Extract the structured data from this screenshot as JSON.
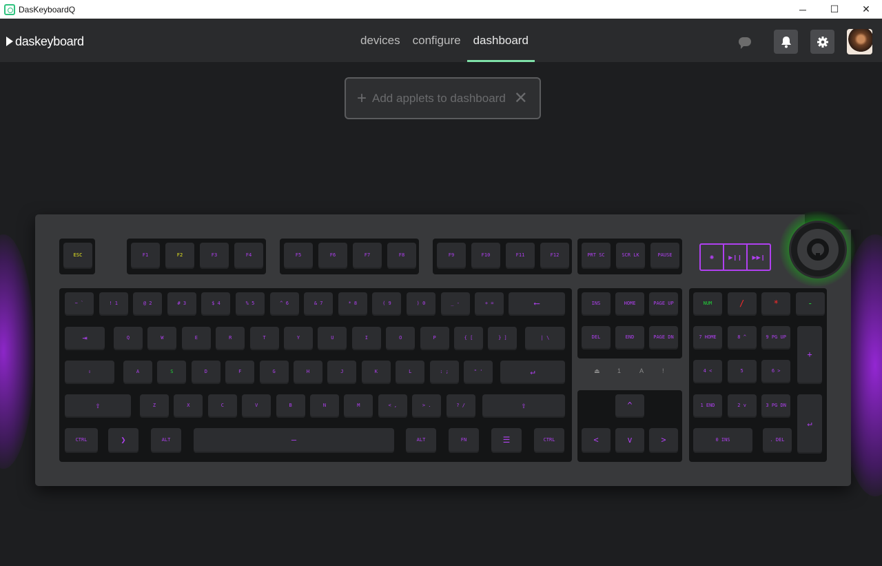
{
  "window": {
    "title": "DasKeyboardQ"
  },
  "header": {
    "logo_text": "daskeyboard",
    "tabs": [
      "devices",
      "configure",
      "dashboard"
    ],
    "active_tab": "dashboard"
  },
  "applet_bar": {
    "label": "Add applets to dashboard"
  },
  "keyboard": {
    "lighting": {
      "base": "#b040f0",
      "yellow": "#e8e820",
      "green": "#22d43a",
      "red": "#ff2a2a",
      "dial": "#28e628"
    },
    "indicators": [
      "⏏",
      "1",
      "A",
      "!"
    ],
    "keys": [
      {
        "id": "esc",
        "label": "ESC",
        "sub": "",
        "c": "ylw"
      },
      {
        "id": "f1",
        "label": "F1",
        "c": ""
      },
      {
        "id": "f2",
        "label": "F2",
        "c": "ylw"
      },
      {
        "id": "f3",
        "label": "F3",
        "c": ""
      },
      {
        "id": "f4",
        "label": "F4",
        "c": ""
      },
      {
        "id": "f5",
        "label": "F5",
        "c": ""
      },
      {
        "id": "f6",
        "label": "F6",
        "c": ""
      },
      {
        "id": "f7",
        "label": "F7",
        "c": ""
      },
      {
        "id": "f8",
        "label": "F8",
        "c": ""
      },
      {
        "id": "f9",
        "label": "F9",
        "c": ""
      },
      {
        "id": "f10",
        "label": "F10",
        "c": ""
      },
      {
        "id": "f11",
        "label": "F11",
        "c": ""
      },
      {
        "id": "f12",
        "label": "F12",
        "c": ""
      },
      {
        "id": "prtsc",
        "label": "PRT SC",
        "c": ""
      },
      {
        "id": "scrlk",
        "label": "SCR LK",
        "c": ""
      },
      {
        "id": "pause",
        "label": "PAUSE",
        "c": ""
      },
      {
        "id": "tilde",
        "label": "~ `",
        "c": ""
      },
      {
        "id": "1",
        "label": "! 1",
        "c": ""
      },
      {
        "id": "2",
        "label": "@ 2",
        "c": ""
      },
      {
        "id": "3",
        "label": "# 3",
        "c": ""
      },
      {
        "id": "4",
        "label": "$ 4",
        "c": ""
      },
      {
        "id": "5",
        "label": "% 5",
        "c": ""
      },
      {
        "id": "6",
        "label": "^ 6",
        "c": ""
      },
      {
        "id": "7",
        "label": "& 7",
        "c": ""
      },
      {
        "id": "8",
        "label": "* 8",
        "c": ""
      },
      {
        "id": "9",
        "label": "( 9",
        "c": ""
      },
      {
        "id": "0",
        "label": ") 0",
        "c": ""
      },
      {
        "id": "minus",
        "label": "_ -",
        "c": ""
      },
      {
        "id": "equal",
        "label": "+ =",
        "c": ""
      },
      {
        "id": "backspace",
        "label": "⟵",
        "c": "",
        "big": true
      },
      {
        "id": "tab",
        "label": "⇥",
        "c": "",
        "big": true
      },
      {
        "id": "q",
        "label": "Q",
        "c": ""
      },
      {
        "id": "w",
        "label": "W",
        "c": ""
      },
      {
        "id": "e",
        "label": "E",
        "c": ""
      },
      {
        "id": "r",
        "label": "R",
        "c": ""
      },
      {
        "id": "t",
        "label": "T",
        "c": ""
      },
      {
        "id": "y",
        "label": "Y",
        "c": ""
      },
      {
        "id": "u",
        "label": "U",
        "c": ""
      },
      {
        "id": "i",
        "label": "I",
        "c": ""
      },
      {
        "id": "o",
        "label": "O",
        "c": ""
      },
      {
        "id": "p",
        "label": "P",
        "c": ""
      },
      {
        "id": "lbracket",
        "label": "{ [",
        "c": ""
      },
      {
        "id": "rbracket",
        "label": "} ]",
        "c": ""
      },
      {
        "id": "backslash",
        "label": "| \\",
        "c": ""
      },
      {
        "id": "caps",
        "label": "⇪",
        "c": ""
      },
      {
        "id": "a",
        "label": "A",
        "c": ""
      },
      {
        "id": "s",
        "label": "S",
        "c": "grn"
      },
      {
        "id": "d",
        "label": "D",
        "c": ""
      },
      {
        "id": "f",
        "label": "F",
        "c": ""
      },
      {
        "id": "g",
        "label": "G",
        "c": ""
      },
      {
        "id": "h",
        "label": "H",
        "c": ""
      },
      {
        "id": "j",
        "label": "J",
        "c": ""
      },
      {
        "id": "k",
        "label": "K",
        "c": ""
      },
      {
        "id": "l",
        "label": "L",
        "c": ""
      },
      {
        "id": "semicolon",
        "label": ": ;",
        "c": ""
      },
      {
        "id": "quote",
        "label": "\" '",
        "c": ""
      },
      {
        "id": "enter",
        "label": "↵",
        "c": "",
        "big": true
      },
      {
        "id": "lshift",
        "label": "⇧",
        "c": "",
        "big": true
      },
      {
        "id": "z",
        "label": "Z",
        "c": ""
      },
      {
        "id": "x",
        "label": "X",
        "c": ""
      },
      {
        "id": "c",
        "label": "C",
        "c": ""
      },
      {
        "id": "v",
        "label": "V",
        "c": ""
      },
      {
        "id": "b",
        "label": "B",
        "c": ""
      },
      {
        "id": "n",
        "label": "N",
        "c": ""
      },
      {
        "id": "m",
        "label": "M",
        "c": ""
      },
      {
        "id": "comma",
        "label": "< ,",
        "c": ""
      },
      {
        "id": "period",
        "label": "> .",
        "c": ""
      },
      {
        "id": "slash",
        "label": "? /",
        "c": ""
      },
      {
        "id": "rshift",
        "label": "⇧",
        "c": "",
        "big": true
      },
      {
        "id": "lctrl",
        "label": "CTRL",
        "c": ""
      },
      {
        "id": "win",
        "label": "❯",
        "c": "",
        "big": true
      },
      {
        "id": "lalt",
        "label": "ALT",
        "c": ""
      },
      {
        "id": "space",
        "label": "—",
        "c": "",
        "big": true
      },
      {
        "id": "ralt",
        "label": "ALT",
        "c": ""
      },
      {
        "id": "fn",
        "label": "FN",
        "c": ""
      },
      {
        "id": "menu",
        "label": "☰",
        "c": "",
        "big": true
      },
      {
        "id": "rctrl",
        "label": "CTRL",
        "c": ""
      },
      {
        "id": "ins",
        "label": "INS",
        "c": ""
      },
      {
        "id": "home",
        "label": "HOME",
        "c": ""
      },
      {
        "id": "pgup",
        "label": "PAGE UP",
        "c": ""
      },
      {
        "id": "del",
        "label": "DEL",
        "c": ""
      },
      {
        "id": "end",
        "label": "END",
        "c": ""
      },
      {
        "id": "pgdn",
        "label": "PAGE DN",
        "c": ""
      },
      {
        "id": "up",
        "label": "^",
        "c": "",
        "big": true
      },
      {
        "id": "left",
        "label": "<",
        "c": "",
        "big": true
      },
      {
        "id": "down",
        "label": "v",
        "c": "",
        "big": true
      },
      {
        "id": "right",
        "label": ">",
        "c": "",
        "big": true
      },
      {
        "id": "numlock",
        "label": "NUM",
        "c": "grn"
      },
      {
        "id": "numdiv",
        "label": "/",
        "c": "red",
        "big": true
      },
      {
        "id": "nummul",
        "label": "*",
        "c": "red",
        "big": true
      },
      {
        "id": "numsub",
        "label": "-",
        "c": "grn",
        "big": true
      },
      {
        "id": "num7",
        "label": "7 HOME",
        "c": ""
      },
      {
        "id": "num8",
        "label": "8 ^",
        "c": ""
      },
      {
        "id": "num9",
        "label": "9 PG UP",
        "c": ""
      },
      {
        "id": "numadd",
        "label": "+",
        "c": "",
        "big": true
      },
      {
        "id": "num4",
        "label": "4 <",
        "c": ""
      },
      {
        "id": "num5",
        "label": "5",
        "c": ""
      },
      {
        "id": "num6",
        "label": "6 >",
        "c": ""
      },
      {
        "id": "num1",
        "label": "1 END",
        "c": ""
      },
      {
        "id": "num2",
        "label": "2 v",
        "c": ""
      },
      {
        "id": "num3",
        "label": "3 PG DN",
        "c": ""
      },
      {
        "id": "numenter",
        "label": "↵",
        "c": "",
        "big": true
      },
      {
        "id": "num0",
        "label": "0 INS",
        "c": ""
      },
      {
        "id": "numdot",
        "label": ". DEL",
        "c": ""
      }
    ],
    "media_keys": [
      "✺",
      "▶❙❙",
      "▶▶❙"
    ]
  }
}
